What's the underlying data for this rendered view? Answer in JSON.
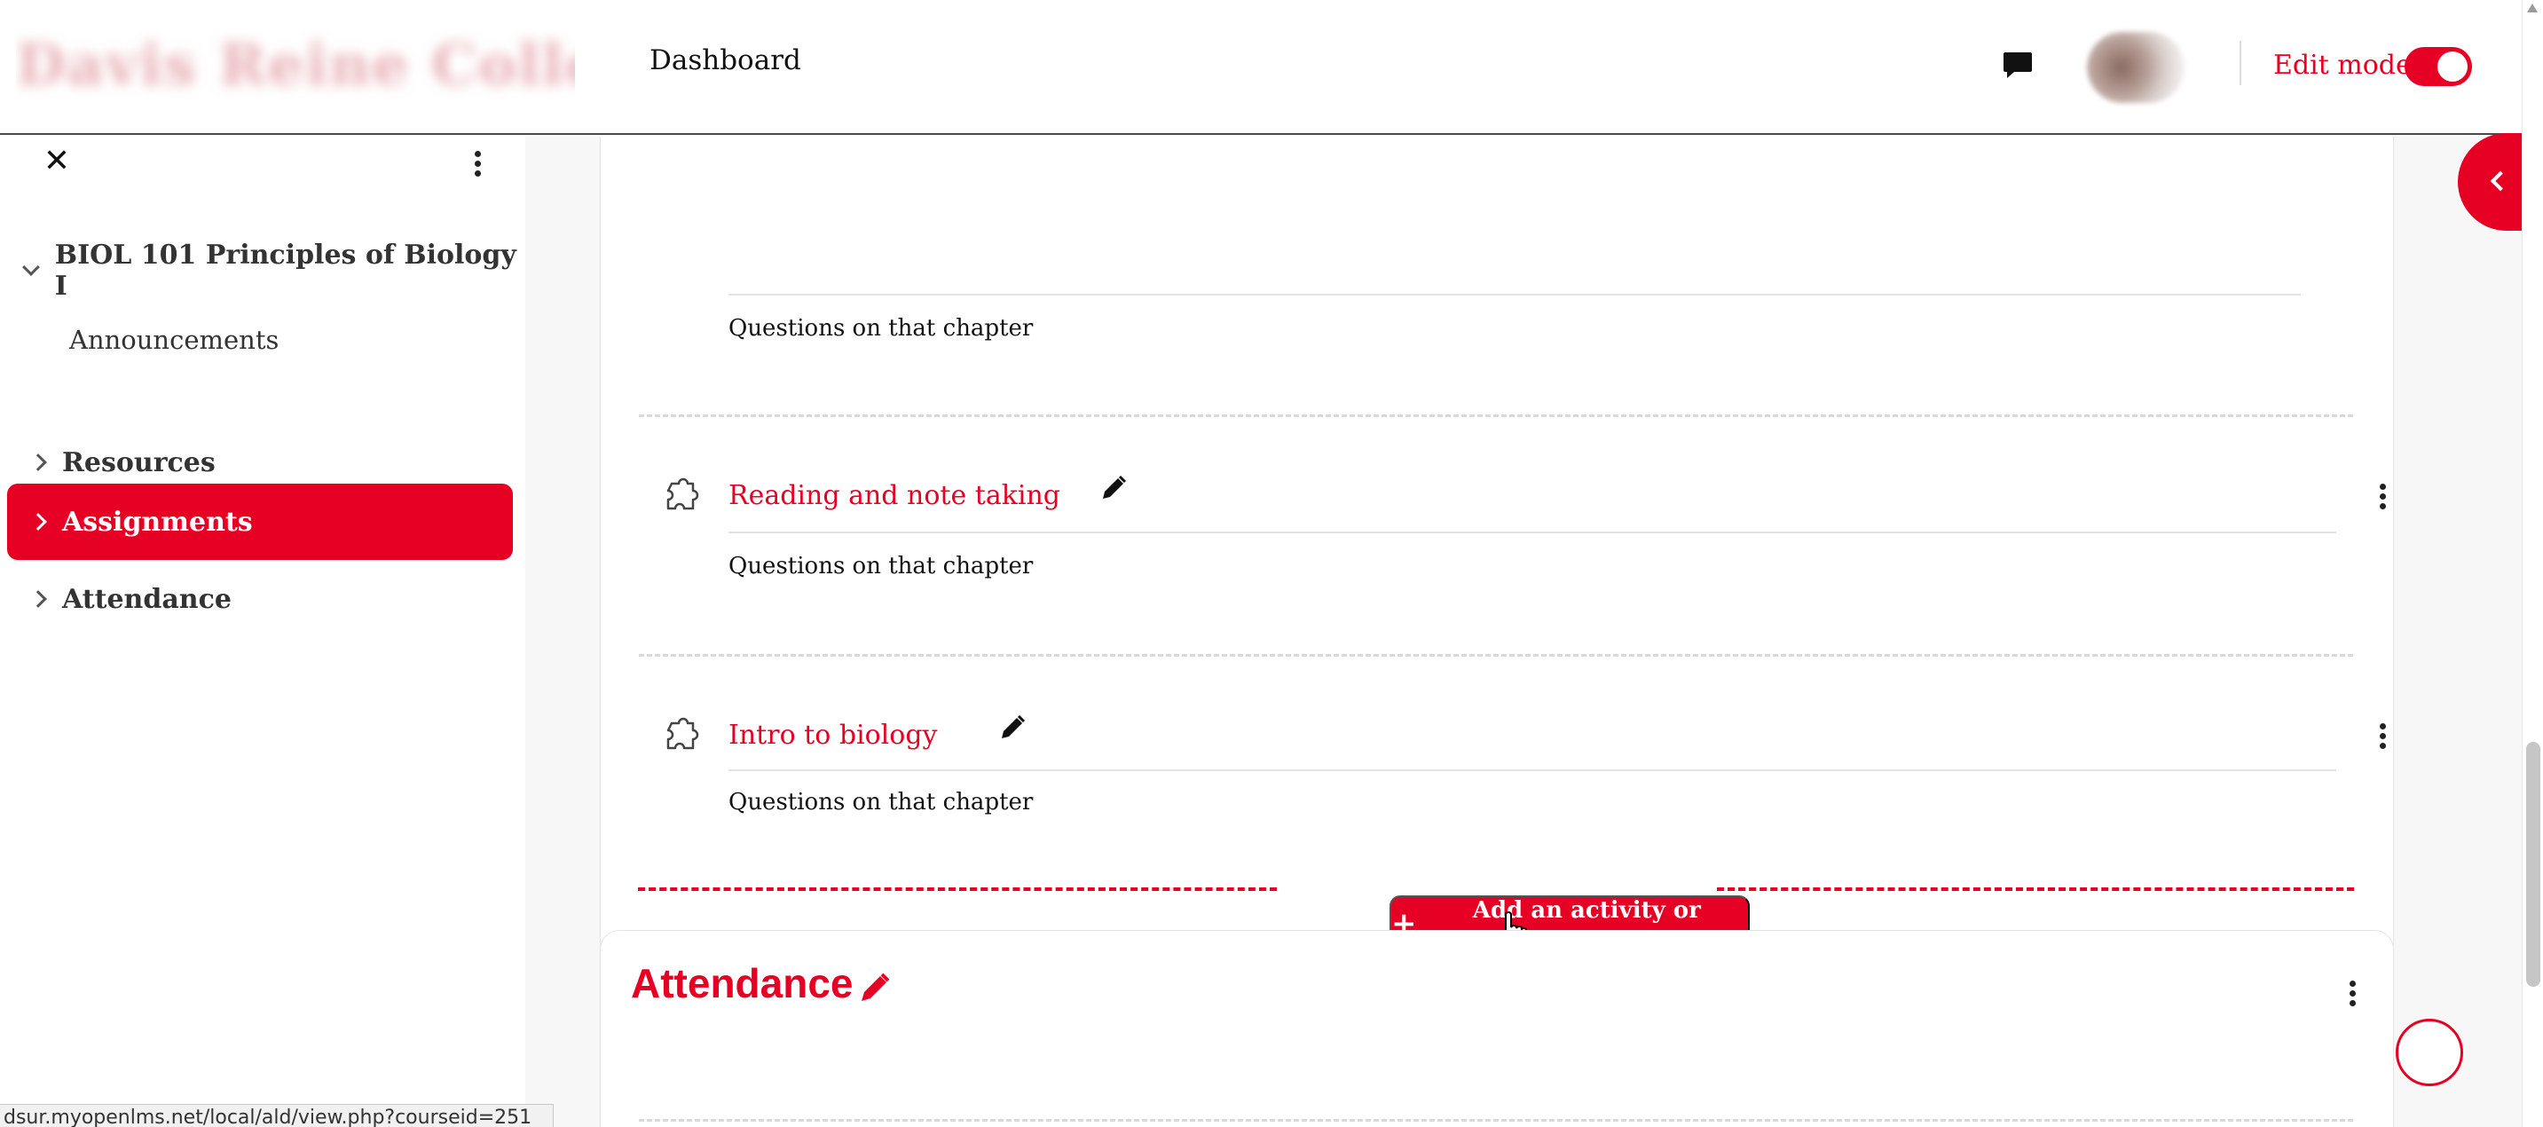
{
  "navbar": {
    "logo_text": "Davis Reine College",
    "dashboard_label": "Dashboard",
    "edit_mode_label": "Edit mode",
    "edit_mode_on": true
  },
  "drawer": {
    "course_name": "BIOL 101 Principles of Biology I",
    "announcements_label": "Announcements",
    "sections": [
      {
        "label": "Resources",
        "active": false
      },
      {
        "label": "Assignments",
        "active": true
      },
      {
        "label": "Attendance",
        "active": false
      }
    ]
  },
  "status_bar": {
    "url": "dsur.myopenlms.net/local/ald/view.php?courseid=251"
  },
  "assignments": {
    "activities": [
      {
        "title": "",
        "description": "Questions on that chapter",
        "icon": "puzzle-icon"
      },
      {
        "title": "Reading and note taking",
        "description": "Questions on that chapter",
        "icon": "puzzle-icon"
      },
      {
        "title": "Intro to biology",
        "description": "Questions on that chapter",
        "icon": "puzzle-icon"
      }
    ],
    "add_button_label": "Add an activity or resource"
  },
  "attendance": {
    "title": "Attendance"
  },
  "colors": {
    "accent": "#e60023",
    "background": "#f7f7f8",
    "card": "#ffffff",
    "text": "#1a1a1a"
  }
}
